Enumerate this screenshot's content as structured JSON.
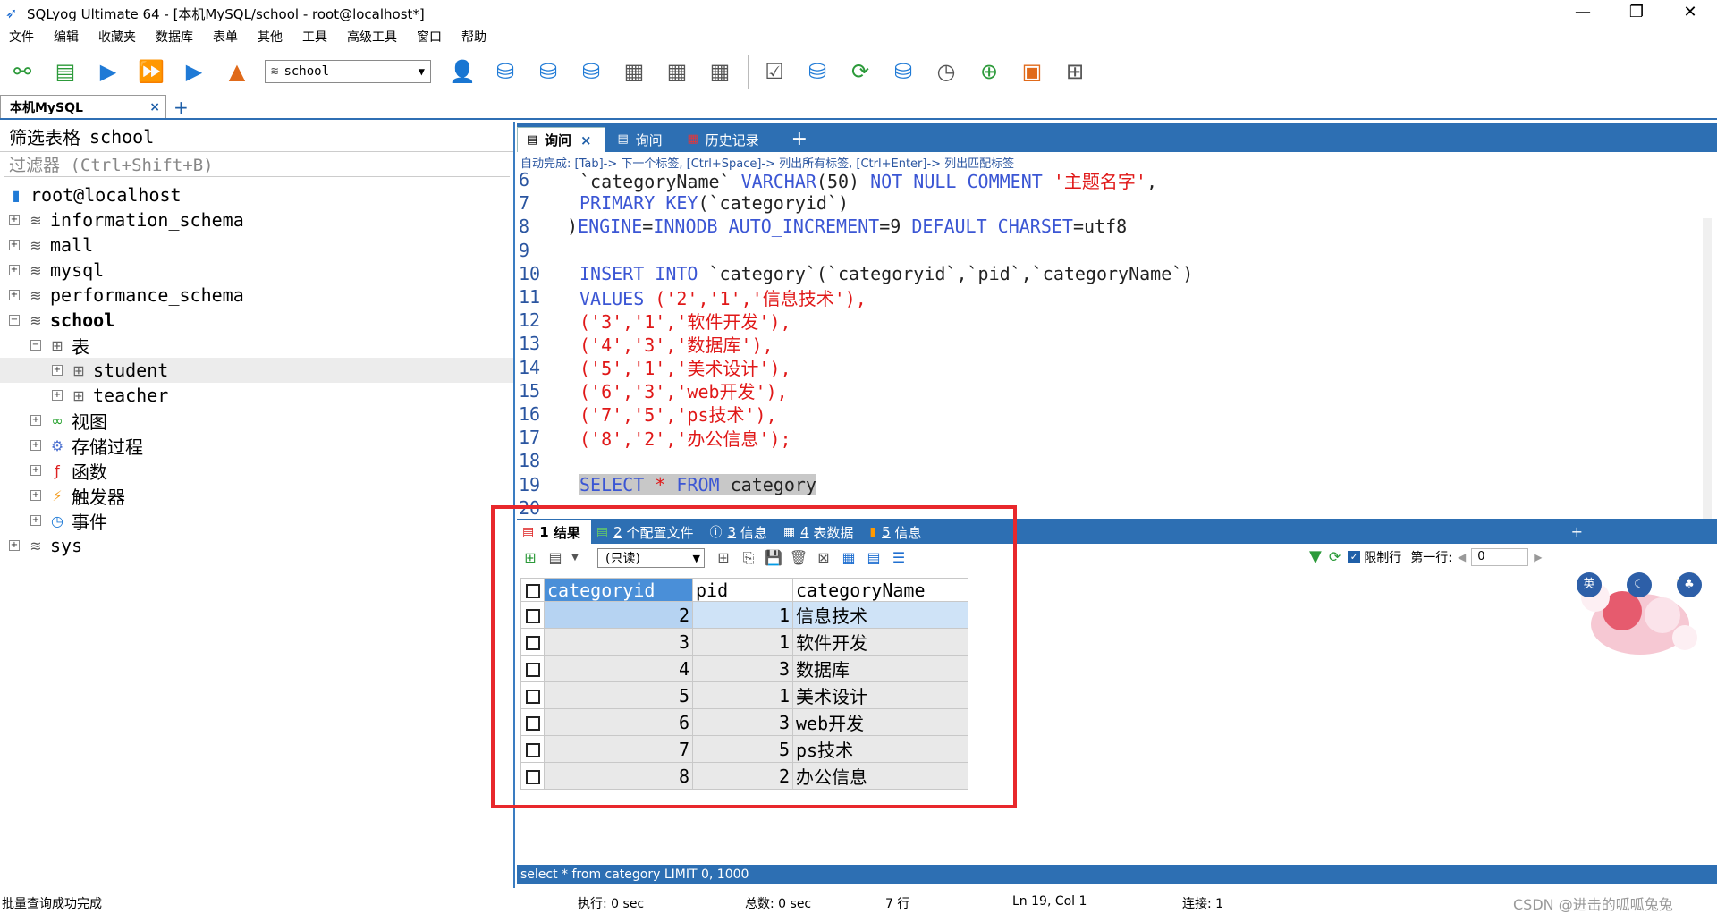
{
  "window": {
    "title": "SQLyog Ultimate 64 - [本机MySQL/school - root@localhost*]",
    "minimize": "—",
    "restore": "❐",
    "close": "✕"
  },
  "menu": [
    "文件",
    "编辑",
    "收藏夹",
    "数据库",
    "表单",
    "其他",
    "工具",
    "高级工具",
    "窗口",
    "帮助"
  ],
  "toolbar": {
    "db_select_value": "school"
  },
  "connection_tab": {
    "label": "本机MySQL",
    "close": "×",
    "add": "+"
  },
  "sidebar": {
    "filter_label": "筛选表格",
    "filter_db": "school",
    "filter_placeholder": "过滤器 (Ctrl+Shift+B)",
    "root": "root@localhost",
    "databases": {
      "information_schema": "information_schema",
      "mall": "mall",
      "mysql": "mysql",
      "performance_schema": "performance_schema",
      "school": "school",
      "sys": "sys"
    },
    "school_children": {
      "tables": "表",
      "student": "student",
      "teacher": "teacher",
      "views": "视图",
      "procedures": "存储过程",
      "functions": "函数",
      "triggers": "触发器",
      "events": "事件"
    }
  },
  "query_tabs": [
    {
      "label": "询问",
      "close": "×"
    },
    {
      "label": "询问"
    },
    {
      "label": "历史记录"
    }
  ],
  "query_tabs_add": "+",
  "autocomplete_hint": "自动完成:  [Tab]-> 下一个标签,  [Ctrl+Space]-> 列出所有标签,  [Ctrl+Enter]-> 列出匹配标签",
  "editor": {
    "lines": {
      "l6": {
        "n": "6",
        "a": "`categoryName` ",
        "b": "VARCHAR",
        "c": "(50) ",
        "d": "NOT NULL COMMENT ",
        "e": "'主题名字'",
        "f": ","
      },
      "l7": {
        "n": "7",
        "a": "PRIMARY KEY",
        "b": "(`categoryid`)"
      },
      "l8": {
        "n": "8",
        "a": ")",
        "b": "ENGINE",
        "c": "=",
        "d": "INNODB AUTO_INCREMENT",
        "e": "=9 ",
        "f": "DEFAULT CHARSET",
        "g": "=utf8"
      },
      "l9": {
        "n": "9"
      },
      "l10": {
        "n": "10",
        "a": "INSERT INTO ",
        "b": "`category`(`categoryid`,`pid`,`categoryName`)"
      },
      "l11": {
        "n": "11",
        "a": "VALUES ",
        "b": "('2','1','信息技术'),"
      },
      "l12": {
        "n": "12",
        "b": "('3','1','软件开发'),"
      },
      "l13": {
        "n": "13",
        "b": "('4','3','数据库'),"
      },
      "l14": {
        "n": "14",
        "b": "('5','1','美术设计'),"
      },
      "l15": {
        "n": "15",
        "b": "('6','3','web开发'),"
      },
      "l16": {
        "n": "16",
        "b": "('7','5','ps技术'),"
      },
      "l17": {
        "n": "17",
        "b": "('8','2','办公信息');"
      },
      "l18": {
        "n": "18"
      },
      "l19": {
        "n": "19",
        "a": "SELECT ",
        "b": "* ",
        "c": "FROM ",
        "d": "category"
      },
      "l20": {
        "n": "20"
      }
    }
  },
  "result_tabs": [
    {
      "num": "1",
      "label": "结果"
    },
    {
      "num": "2",
      "label": "个配置文件"
    },
    {
      "num": "3",
      "label": "信息"
    },
    {
      "num": "4",
      "label": "表数据"
    },
    {
      "num": "5",
      "label": "信息"
    }
  ],
  "result_tabs_add": "+",
  "result_toolbar": {
    "mode": "(只读)",
    "limit_label": "限制行",
    "first_row_label": "第一行:",
    "first_row_value": "0"
  },
  "result_grid": {
    "columns": [
      "categoryid",
      "pid",
      "categoryName"
    ],
    "rows": [
      [
        "2",
        "1",
        "信息技术"
      ],
      [
        "3",
        "1",
        "软件开发"
      ],
      [
        "4",
        "3",
        "数据库"
      ],
      [
        "5",
        "1",
        "美术设计"
      ],
      [
        "6",
        "3",
        "web开发"
      ],
      [
        "7",
        "5",
        "ps技术"
      ],
      [
        "8",
        "2",
        "办公信息"
      ]
    ]
  },
  "editor_status": "select * from category LIMIT 0, 1000",
  "statusbar": {
    "message": "批量查询成功完成",
    "exec": "执行: 0 sec",
    "total": "总数: 0 sec",
    "rows": "7 行",
    "position": "Ln 19, Col 1",
    "connections": "连接: 1",
    "watermark": "CSDN @进击的呱呱兔兔"
  },
  "colors": {
    "accent": "#2d6fb3",
    "keyword": "#3b56d4",
    "string": "#e01818",
    "highlight_box": "#e8282c"
  }
}
